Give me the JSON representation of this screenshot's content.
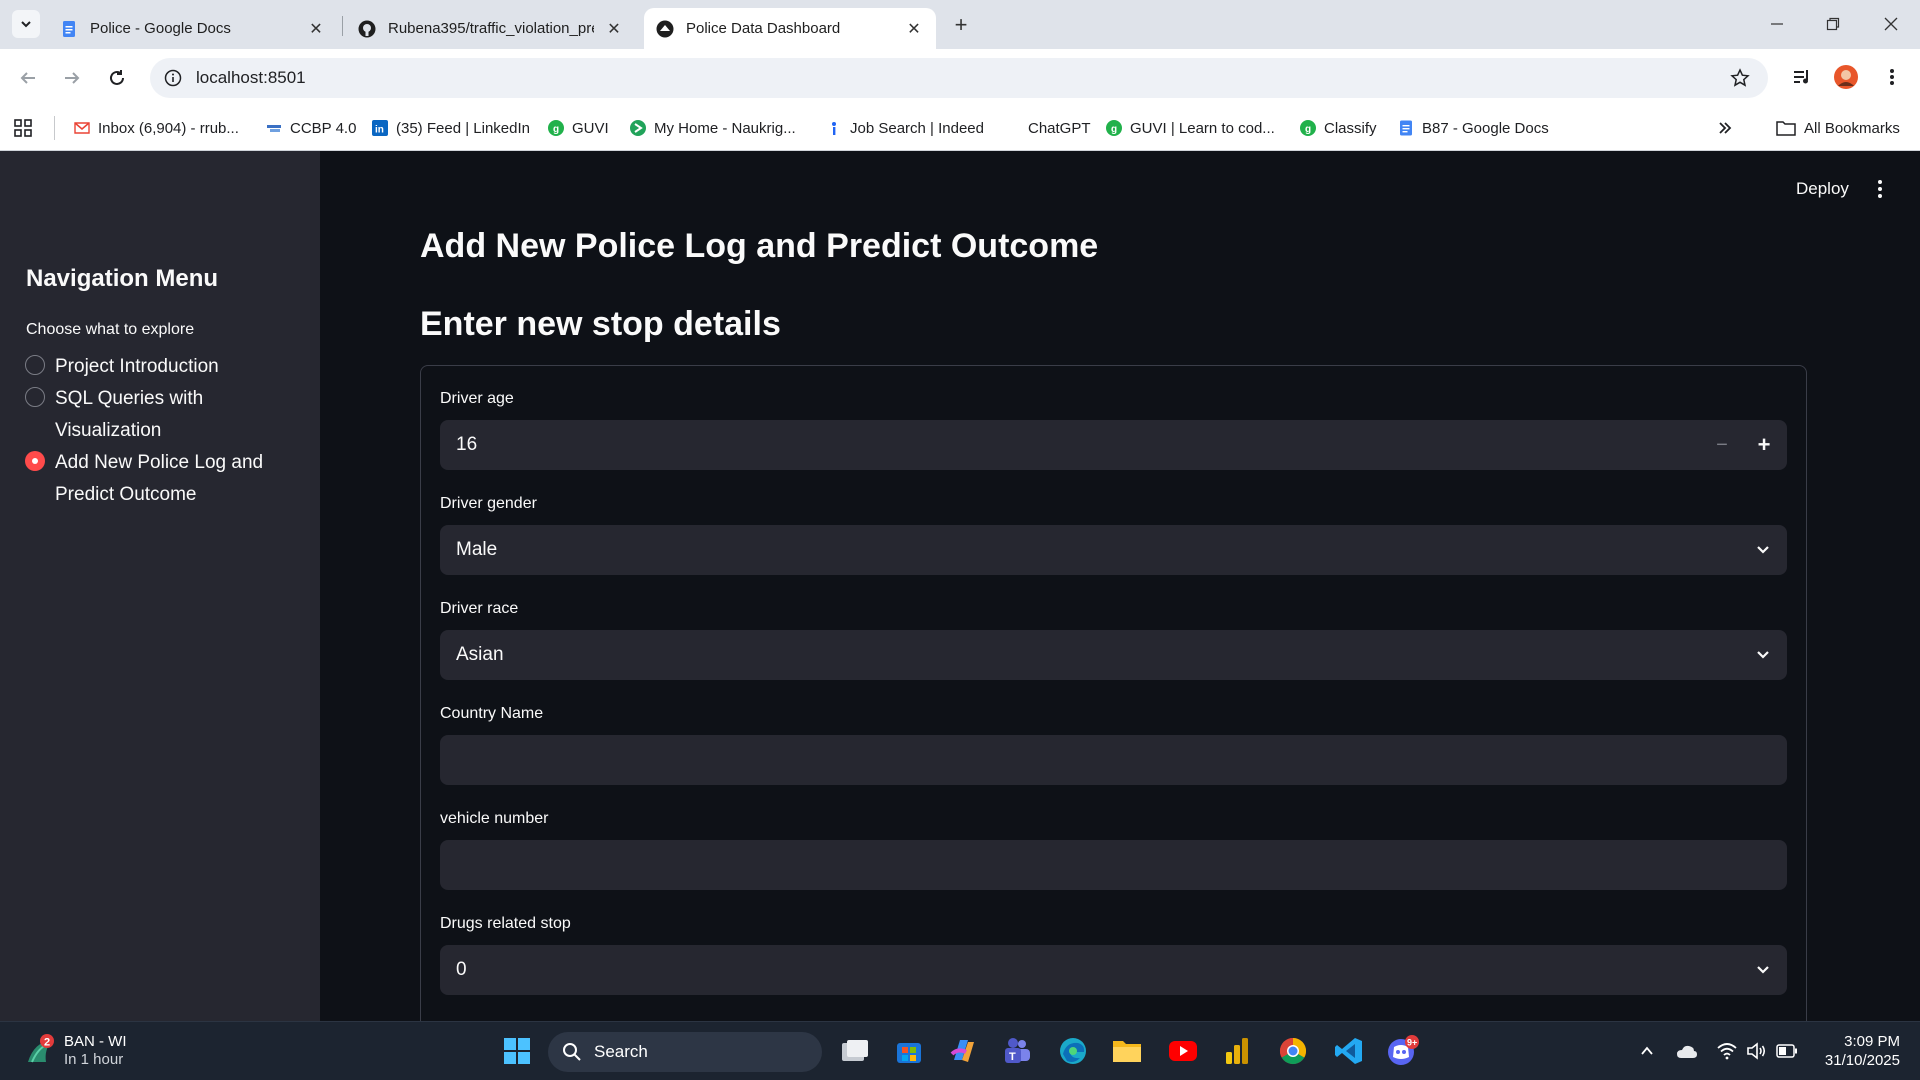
{
  "browser": {
    "tabs": [
      {
        "title": "Police - Google Docs",
        "active": false
      },
      {
        "title": "Rubena395/traffic_violation_pre",
        "active": false
      },
      {
        "title": "Police Data Dashboard",
        "active": true
      }
    ],
    "url": "localhost:8501",
    "bookmarks": [
      {
        "label": "Inbox (6,904) - rrub...",
        "icon": "gmail-icon"
      },
      {
        "label": "CCBP 4.0",
        "icon": "ccbp-icon"
      },
      {
        "label": "(35) Feed | LinkedIn",
        "icon": "linkedin-icon"
      },
      {
        "label": "GUVI",
        "icon": "guvi-icon"
      },
      {
        "label": "My Home - Naukrig...",
        "icon": "naukri-icon"
      },
      {
        "label": "Job Search | Indeed",
        "icon": "indeed-icon"
      },
      {
        "label": "ChatGPT",
        "icon": "chatgpt-icon"
      },
      {
        "label": "GUVI | Learn to cod...",
        "icon": "guvi-icon"
      },
      {
        "label": "Classify",
        "icon": "guvi-icon"
      },
      {
        "label": "B87 - Google Docs",
        "icon": "google-docs-icon"
      }
    ],
    "all_bookmarks_label": "All Bookmarks"
  },
  "app": {
    "deploy_label": "Deploy",
    "sidebar": {
      "title": "Navigation Menu",
      "caption": "Choose what to explore",
      "options": [
        {
          "label": "Project Introduction",
          "selected": false
        },
        {
          "label": "SQL Queries with Visualization",
          "selected": false
        },
        {
          "label": "Add New Police Log and Predict Outcome",
          "selected": true
        }
      ]
    },
    "page_title": "Add New Police Log and Predict Outcome",
    "section_title": "Enter new stop details",
    "form": {
      "driver_age": {
        "label": "Driver age",
        "value": "16"
      },
      "driver_gender": {
        "label": "Driver gender",
        "value": "Male"
      },
      "driver_race": {
        "label": "Driver race",
        "value": "Asian"
      },
      "country_name": {
        "label": "Country Name",
        "value": ""
      },
      "vehicle_number": {
        "label": "vehicle number",
        "value": ""
      },
      "drugs_related_stop": {
        "label": "Drugs related stop",
        "value": "0"
      }
    },
    "accent_color": "#ff4b4b"
  },
  "taskbar": {
    "weather": {
      "title": "BAN - WI",
      "subtitle": "In 1 hour",
      "badge": "2"
    },
    "search_label": "Search",
    "discord_badge": "9+",
    "time": "3:09 PM",
    "date": "31/10/2025"
  }
}
